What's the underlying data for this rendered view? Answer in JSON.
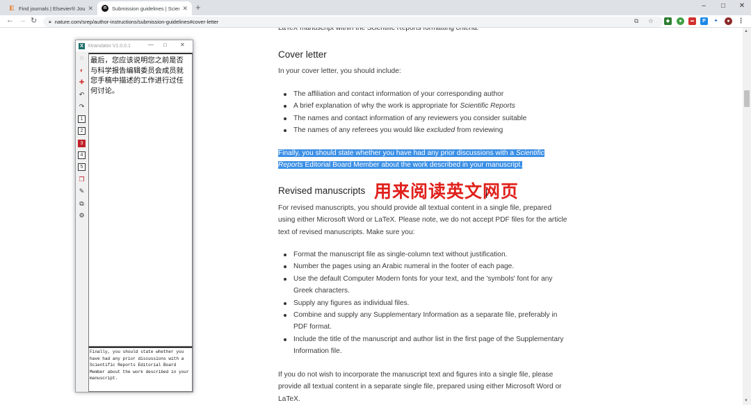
{
  "browser": {
    "tabs": [
      {
        "title": "Find journals | Elsevier® Journ",
        "active": false,
        "favicon": "elsevier-icon"
      },
      {
        "title": "Submission guidelines | Scient",
        "active": true,
        "favicon": "nature-icon"
      }
    ],
    "new_tab_label": "+",
    "url": "nature.com/srep/author-instructions/submission-guidelines#cover-letter",
    "window_controls": [
      "–",
      "□",
      "✕"
    ]
  },
  "article": {
    "top_cut_line": "LaTeX manuscript within the Scientific Reports formatting criteria.",
    "cover_letter": {
      "heading": "Cover letter",
      "intro": "In your cover letter, you should include:",
      "bullets": [
        {
          "pre": "The affiliation and contact information of your corresponding author",
          "em": "",
          "post": ""
        },
        {
          "pre": "A brief explanation of why the work is appropriate for ",
          "em": "Scientific Reports",
          "post": ""
        },
        {
          "pre": "The names and contact information of any reviewers you consider suitable",
          "em": "",
          "post": ""
        },
        {
          "pre": "The names of any referees you would like ",
          "em": "excluded",
          "post": " from reviewing"
        }
      ],
      "selected_para": {
        "pre": "Finally, you should state whether you have had any prior discussions with a ",
        "em": "Scientific Reports",
        "post": " Editorial Board Member about the work described in your manuscript."
      }
    },
    "revised": {
      "heading": "Revised manuscripts",
      "intro": "For revised manuscripts, you should provide all textual content in a single file, prepared using either Microsoft Word or LaTeX. Please note, we do not accept PDF files for the article text of revised manuscripts. Make sure you:",
      "bullets": [
        "Format the manuscript file as single-column text without justification.",
        "Number the pages using an Arabic numeral in the footer of each page.",
        "Use the default Computer Modern fonts for your text, and the 'symbols' font for any Greek characters.",
        "Supply any figures as individual files.",
        "Combine and supply any Supplementary Information as a separate file, preferably in PDF format.",
        "Include the title of the manuscript and author list in the first page of the Supplementary Information file."
      ],
      "outro": "If you do not wish to incorporate the manuscript text and figures into a single file, please provide all textual content in a separate single file, prepared using either Microsoft Word or LaTeX."
    },
    "overlay_caption": "用来阅读英文网页"
  },
  "xtranslator": {
    "title": "Xtranslator V1.0.0.1",
    "translation": "最后，您应该说明您之前是否与科学报告编辑委员会成员就您手稿中描述的工作进行过任何讨论。",
    "source_text": "Finally, you should state whether you have had any prior discussions with a Scientific Reports Editorial Board Member about the work described in your manuscript.",
    "numbered_buttons": [
      "1",
      "2",
      "3",
      "4",
      "5"
    ],
    "active_number": "3"
  },
  "colors": {
    "selection": "#3b8fe5",
    "overlay_red": "#e0201b",
    "active_slot": "#c0202a"
  }
}
